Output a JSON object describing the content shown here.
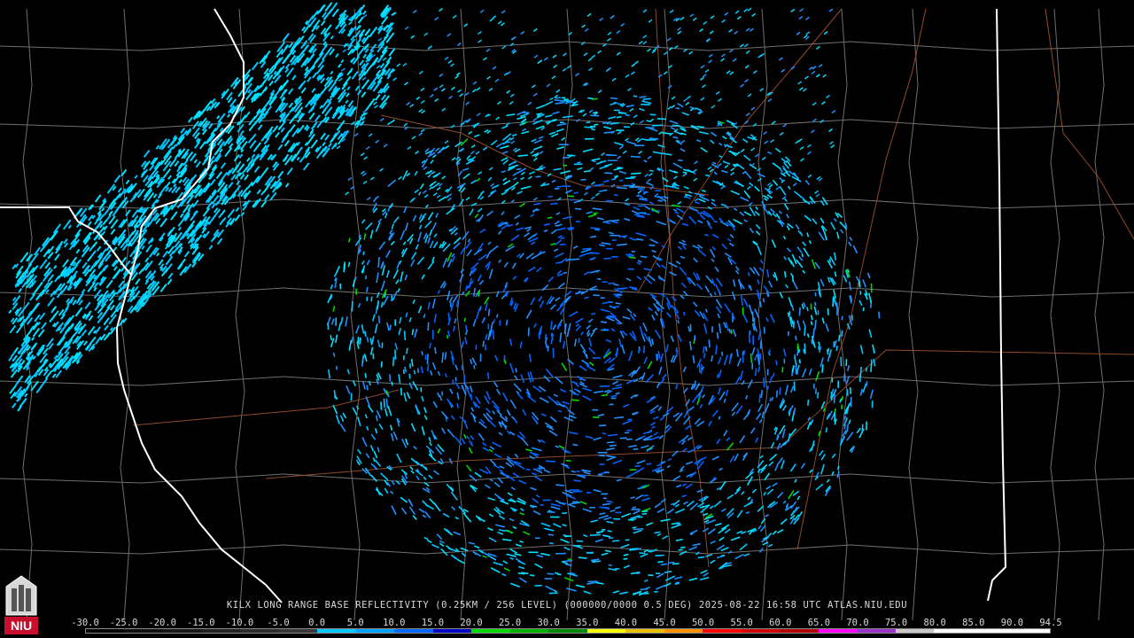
{
  "caption": {
    "product": "KILX LONG RANGE BASE REFLECTIVITY (0.25KM / 256 LEVEL) (000000/0000 0.5 DEG)",
    "datetime": "2025-08-22 16:58 UTC",
    "site": "ATLAS.NIU.EDU"
  },
  "logo": {
    "text": "NIU",
    "color": "#c8102e"
  },
  "legend": {
    "ticks": [
      "-30.0",
      "-25.0",
      "-20.0",
      "-15.0",
      "-10.0",
      "-5.0",
      "0.0",
      "5.0",
      "10.0",
      "15.0",
      "20.0",
      "25.0",
      "30.0",
      "35.0",
      "40.0",
      "45.0",
      "50.0",
      "55.0",
      "60.0",
      "65.0",
      "70.0",
      "75.0",
      "80.0",
      "85.0",
      "90.0",
      "94.5"
    ],
    "colors": [
      "#050505",
      "#0f0f0f",
      "#181818",
      "#222222",
      "#2c2c2c",
      "#383838",
      "#00c8ff",
      "#00a0ff",
      "#0064ff",
      "#0000c8",
      "#00d800",
      "#00b000",
      "#008800",
      "#ffff00",
      "#e8c000",
      "#ff9000",
      "#ff0000",
      "#d00000",
      "#b00000",
      "#ff00ff",
      "#9932cc",
      "#c8c8c8",
      "#ffffff",
      "#ffffff",
      "#ffffff"
    ]
  },
  "map": {
    "state_border_color": "#ffffff",
    "county_border_color": "#6e6e6e",
    "highway_color": "#a0522d",
    "echo_colors": [
      "#00c8ff",
      "#00e0ff",
      "#1e90ff",
      "#0064ff",
      "#00d800"
    ]
  }
}
